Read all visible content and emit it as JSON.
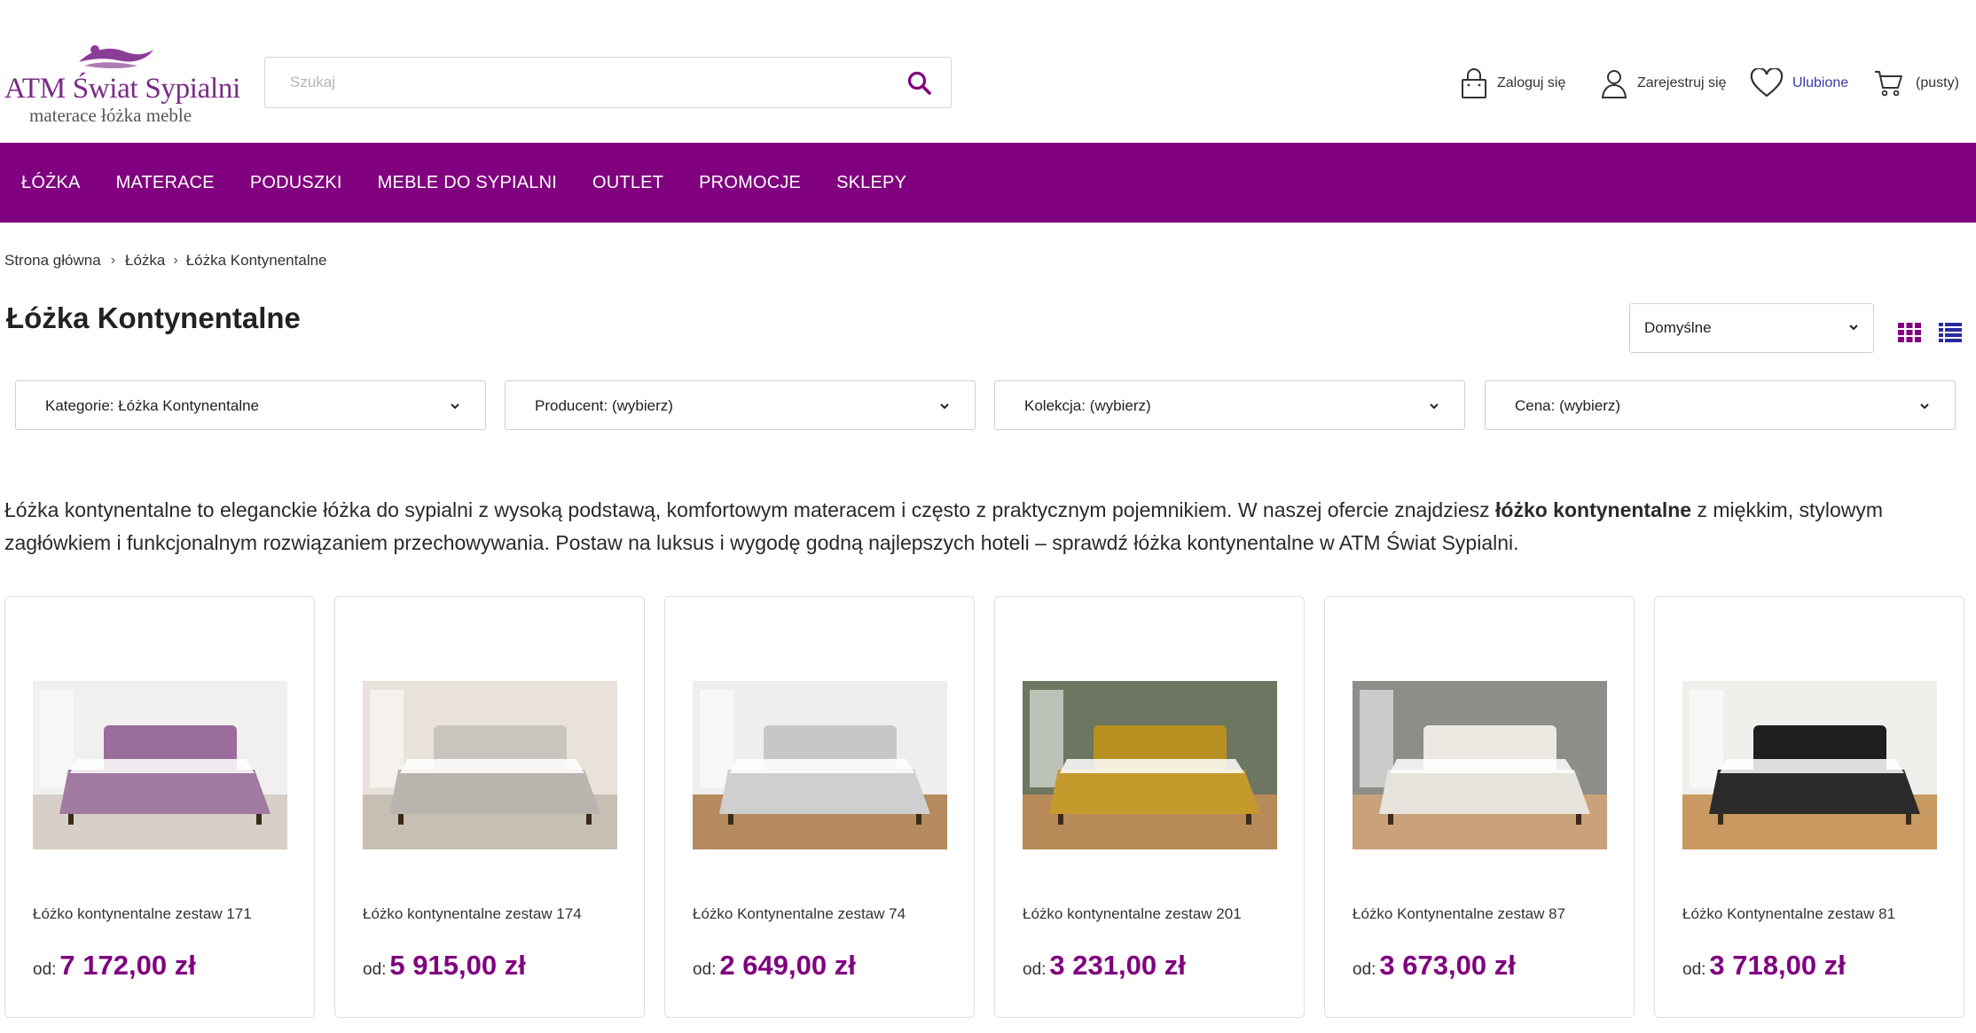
{
  "brand": {
    "title": "ATM Świat Sypialni",
    "tagline": "materace łóżka meble",
    "color": "#80007f"
  },
  "search": {
    "placeholder": "Szukaj",
    "icon": "search-icon"
  },
  "header_links": {
    "login": {
      "label": "Zaloguj się",
      "icon": "lock-bag-icon"
    },
    "register": {
      "label": "Zarejestruj się",
      "icon": "user-icon"
    },
    "favorites": {
      "label": "Ulubione",
      "icon": "heart-icon"
    },
    "cart": {
      "label": "(pusty)",
      "icon": "cart-icon"
    }
  },
  "nav": [
    {
      "label": "ŁÓŻKA"
    },
    {
      "label": "MATERACE"
    },
    {
      "label": "PODUSZKI"
    },
    {
      "label": "MEBLE DO SYPIALNI"
    },
    {
      "label": "OUTLET"
    },
    {
      "label": "PROMOCJE"
    },
    {
      "label": "SKLEPY"
    }
  ],
  "breadcrumb": [
    {
      "label": "Strona główna"
    },
    {
      "label": "Łóżka"
    },
    {
      "label": "Łóżka Kontynentalne"
    }
  ],
  "page_title": "Łóżka Kontynentalne",
  "sort": {
    "selected": "Domyślne"
  },
  "filters": [
    {
      "label": "Kategorie: Łóżka Kontynentalne"
    },
    {
      "label": "Producent: (wybierz)"
    },
    {
      "label": "Kolekcja: (wybierz)"
    },
    {
      "label": "Cena: (wybierz)"
    }
  ],
  "description": {
    "part1": "Łóżka kontynentalne to eleganckie łóżka do sypialni z wysoką podstawą, komfortowym materacem i często z praktycznym pojemnikiem. W naszej ofercie znajdziesz ",
    "bold": "łóżko kontynentalne",
    "part2": " z miękkim, stylowym zagłówkiem i funkcjonalnym rozwiązaniem przechowywania. Postaw na luksus i wygodę godną najlepszych hoteli – sprawdź łóżka kontynentalne w ATM Świat Sypialni."
  },
  "products": [
    {
      "name": "Łóżko kontynentalne zestaw 171",
      "price_prefix": "od:",
      "price": "7 172,00 zł",
      "bed_color": "#a07aa0",
      "headboard_color": "#9a6d9c",
      "wall": "#f2f0ee",
      "floor": "#d8cfc8"
    },
    {
      "name": "Łóżko kontynentalne zestaw 174",
      "price_prefix": "od:",
      "price": "5 915,00 zł",
      "bed_color": "#b9b4ae",
      "headboard_color": "#c9c4be",
      "wall": "#e8e2da",
      "floor": "#c8bfb4"
    },
    {
      "name": "Łóżko Kontynentalne zestaw 74",
      "price_prefix": "od:",
      "price": "2 649,00 zł",
      "bed_color": "#cfcfcf",
      "headboard_color": "#c7c7c7",
      "wall": "#eeeeec",
      "floor": "#b68a5f"
    },
    {
      "name": "Łóżko kontynentalne zestaw 201",
      "price_prefix": "od:",
      "price": "3 231,00 zł",
      "bed_color": "#c59a2c",
      "headboard_color": "#b8901f",
      "wall": "#6c7660",
      "floor": "#b88a58"
    },
    {
      "name": "Łóżko Kontynentalne zestaw 87",
      "price_prefix": "od:",
      "price": "3 673,00 zł",
      "bed_color": "#e6e2dc",
      "headboard_color": "#ece8e2",
      "wall": "#8d8d8a",
      "floor": "#c9a27a"
    },
    {
      "name": "Łóżko Kontynentalne zestaw 81",
      "price_prefix": "od:",
      "price": "3 718,00 zł",
      "bed_color": "#2b2b2b",
      "headboard_color": "#1f1f1f",
      "wall": "#f1efec",
      "floor": "#c89a62"
    }
  ]
}
